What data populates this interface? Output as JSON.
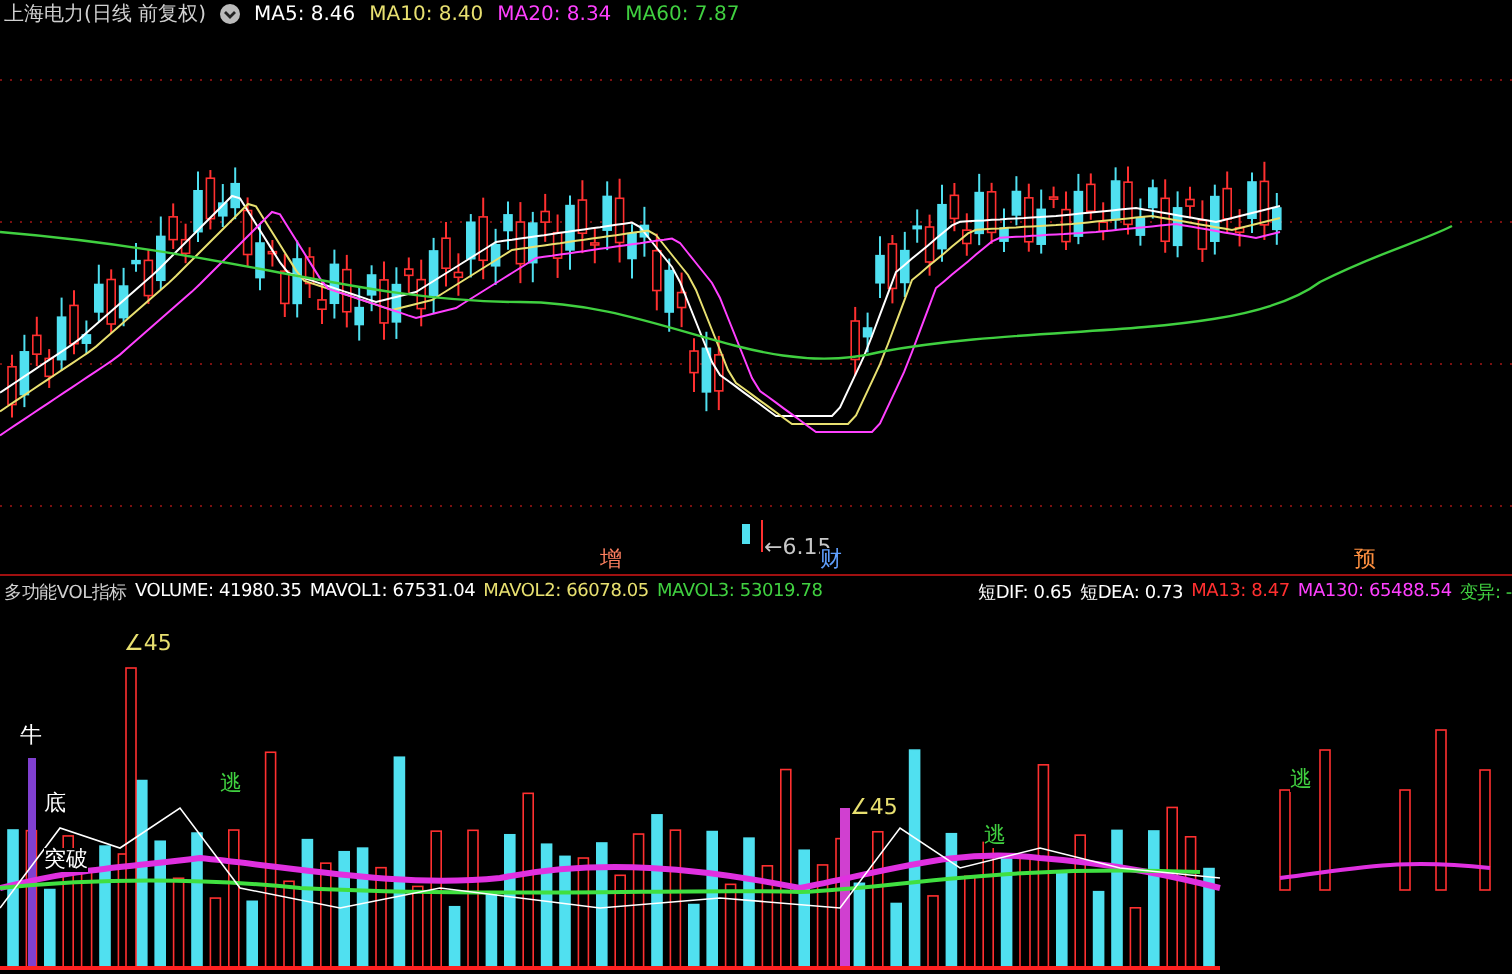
{
  "price_panel": {
    "title": "上海电力(日线 前复权)",
    "indicators": [
      {
        "label": "MA5: 8.46",
        "color": "#ffffff"
      },
      {
        "label": "MA10: 8.40",
        "color": "#e8e070"
      },
      {
        "label": "MA20: 8.34",
        "color": "#ff40ff"
      },
      {
        "label": "MA60: 7.87",
        "color": "#40d040"
      }
    ],
    "annotations": [
      {
        "text": "←6.15",
        "color": "#c8c8c8"
      },
      {
        "text": "增",
        "color": "#ff8060"
      },
      {
        "text": "财",
        "color": "#60a0ff"
      },
      {
        "text": "预",
        "color": "#ff9040"
      }
    ]
  },
  "indicator_panel": {
    "name": "多功能VOL指标",
    "values": [
      {
        "label": "VOLUME: 41980.35",
        "color": "#ffffff"
      },
      {
        "label": "MAVOL1: 67531.04",
        "color": "#ffffff"
      },
      {
        "label": "MAVOL2: 66078.05",
        "color": "#e8e070"
      },
      {
        "label": "MAVOL3: 53019.78",
        "color": "#40d040"
      },
      {
        "label": "短DIF: 0.65",
        "color": "#ffffff"
      },
      {
        "label": "短DEA: 0.73",
        "color": "#ffffff"
      },
      {
        "label": "MA13: 8.47",
        "color": "#ff3030"
      },
      {
        "label": "MA130: 65488.54",
        "color": "#ff40ff"
      },
      {
        "label": "变异: -",
        "color": "#40d040"
      }
    ],
    "annotations": [
      {
        "text": "∠45",
        "color": "#e8e070"
      },
      {
        "text": "牛",
        "color": "#ffffff"
      },
      {
        "text": "底",
        "color": "#ffffff"
      },
      {
        "text": "突破",
        "color": "#ffffff"
      },
      {
        "text": "逃",
        "color": "#40d040"
      },
      {
        "text": "∠45",
        "color": "#e8e070"
      },
      {
        "text": "逃",
        "color": "#40d040"
      },
      {
        "text": "逃",
        "color": "#40d040"
      }
    ]
  }
}
